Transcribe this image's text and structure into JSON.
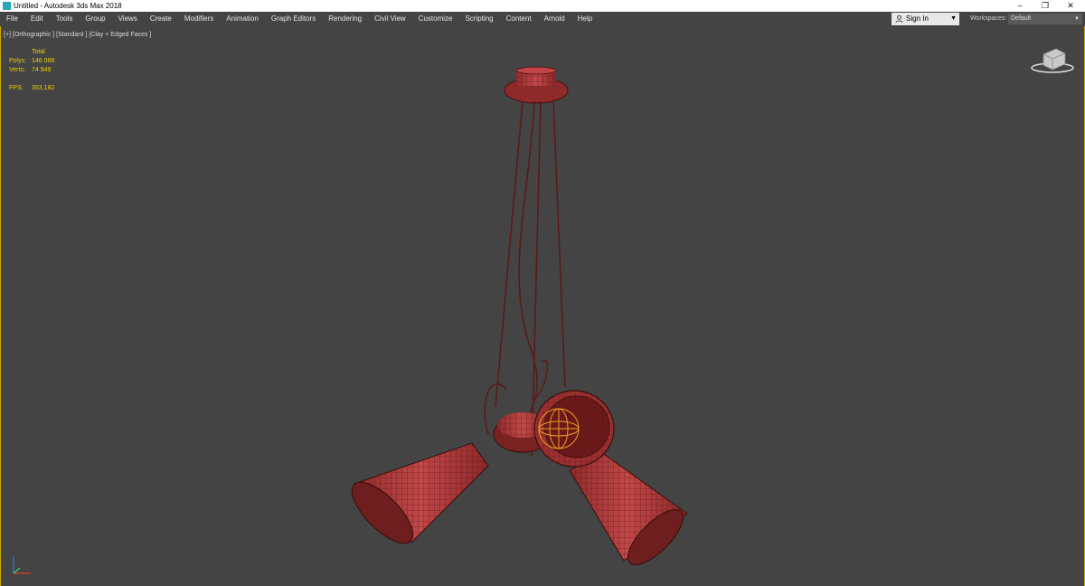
{
  "window": {
    "title": "Untitled - Autodesk 3ds Max 2018",
    "controls": {
      "minimize": "–",
      "restore": "❐",
      "close": "✕"
    }
  },
  "menu": {
    "items": [
      "File",
      "Edit",
      "Tools",
      "Group",
      "Views",
      "Create",
      "Modifiers",
      "Animation",
      "Graph Editors",
      "Rendering",
      "Civil View",
      "Customize",
      "Scripting",
      "Content",
      "Arnold",
      "Help"
    ]
  },
  "account": {
    "signin_label": "Sign In",
    "icon": "user-icon"
  },
  "workspaces": {
    "label": "Workspaces:",
    "value": "Default"
  },
  "viewport": {
    "label": "[+] [Orthographic ] [Standard ] [Clay + Edged Faces ]",
    "stats": {
      "header": "Total",
      "polys_label": "Polys:",
      "polys_value": "146 088",
      "verts_label": "Verts:",
      "verts_value": "74 949",
      "fps_label": "FPS:",
      "fps_value": "353,182"
    }
  },
  "colors": {
    "viewport_bg": "#444444",
    "model_red": "#b23a3a",
    "wire_red": "#5a1414",
    "stats_yellow": "#e8d100",
    "selection_orange": "#f0a020"
  }
}
